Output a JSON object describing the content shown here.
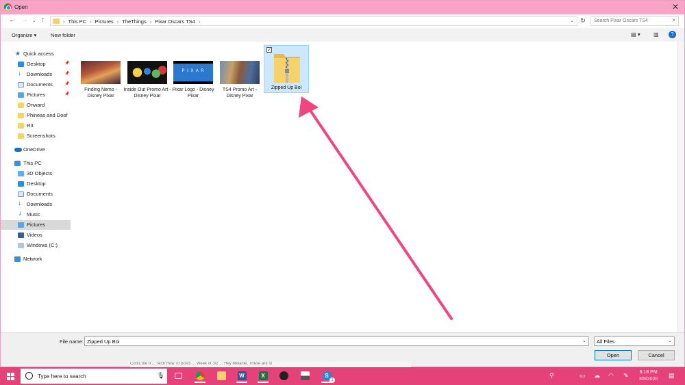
{
  "window": {
    "title": "Open"
  },
  "address": {
    "crumbs": [
      "This PC",
      "Pictures",
      "TheThings",
      "Pixar Oscars TS4"
    ],
    "search_placeholder": "Search Pixar Oscars TS4"
  },
  "toolbar": {
    "organize": "Organize",
    "new_folder": "New folder"
  },
  "nav": {
    "quick_access": "Quick access",
    "qa_items": [
      "Desktop",
      "Downloads",
      "Documents",
      "Pictures",
      "Onward",
      "Phineas and Doof",
      "R3",
      "Screenshots"
    ],
    "onedrive": "OneDrive",
    "this_pc": "This PC",
    "pc_items": [
      "3D Objects",
      "Desktop",
      "Documents",
      "Downloads",
      "Music",
      "Pictures",
      "Videos",
      "Windows (C:)"
    ],
    "network": "Network"
  },
  "files": [
    {
      "name": "Finding Nemo - Disney Pixar"
    },
    {
      "name": "Inside Out Promo Art - Disney Pixar"
    },
    {
      "name": "Pixar Logo - Disney Pixar"
    },
    {
      "name": "TS4 Promo Art - Disney Pixar"
    }
  ],
  "selected_item": {
    "name": "Zipped Up Boi",
    "checkbox": "✓"
  },
  "pixar_logo_text": "P I X A R",
  "bottom": {
    "file_name_label": "File name:",
    "file_name_value": "Zipped Up Boi",
    "filter": "All Files",
    "open_button": "Open",
    "cancel_button": "Cancel"
  },
  "taskbar": {
    "search_placeholder": "Type here to search",
    "ghost_text": "Confi, file 0 ... Tech How To posts ... Week of 3/2 ... Hey Melanie, These are st",
    "time": "6:18 PM",
    "date": "3/9/2020",
    "notification_count": "1"
  },
  "colors": {
    "accent_pink": "#e6427a",
    "title_pink": "#f9a3c7",
    "selection": "#cce8ff",
    "folder_yellow": "#f6d26b"
  }
}
